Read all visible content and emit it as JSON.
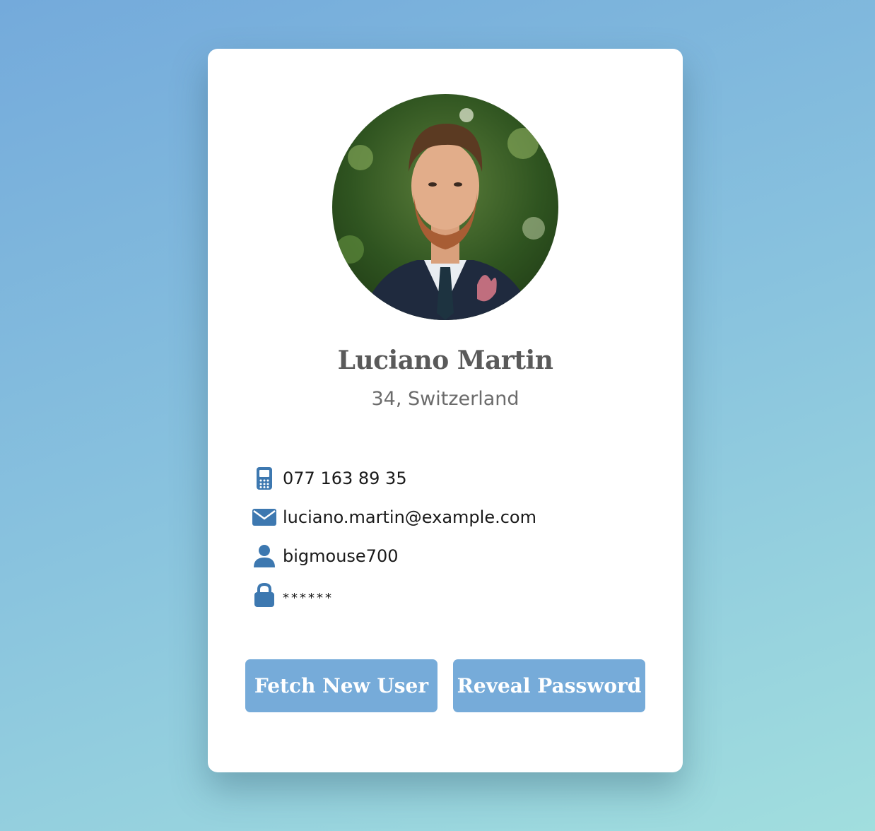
{
  "user": {
    "name": "Luciano Martin",
    "age_country": "34, Switzerland",
    "phone": "077 163 89 35",
    "email": "luciano.martin@example.com",
    "username": "bigmouse700",
    "password": "******"
  },
  "buttons": {
    "fetch_label": "Fetch New User",
    "reveal_label": "Reveal Password"
  },
  "icons": {
    "phone": "mobile-phone-icon",
    "email": "envelope-icon",
    "username": "user-icon",
    "password": "lock-icon"
  },
  "colors": {
    "accent": "#76abd9",
    "icon": "#3d78b0",
    "card": "#ffffff"
  }
}
